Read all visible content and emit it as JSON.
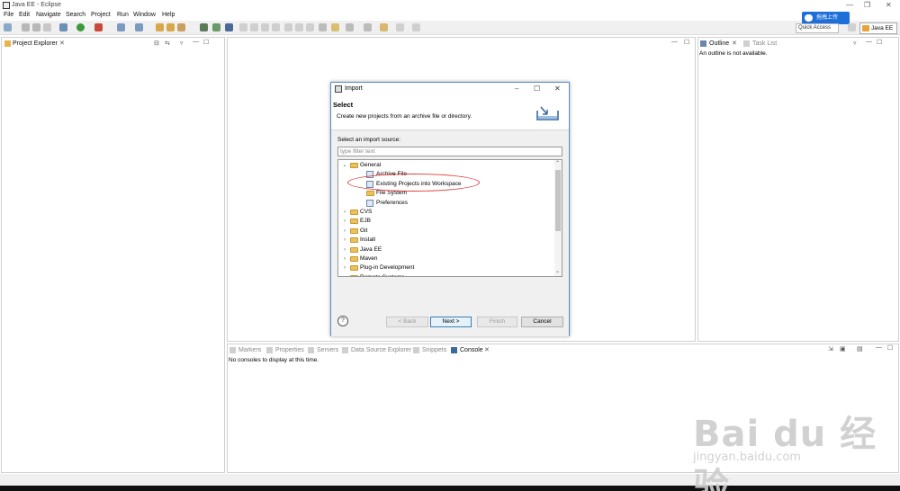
{
  "window": {
    "title": "Java EE - Eclipse",
    "minimize": "—",
    "restore": "❐",
    "close": "✕"
  },
  "menu": [
    "File",
    "Edit",
    "Navigate",
    "Search",
    "Project",
    "Run",
    "Window",
    "Help"
  ],
  "toolbar": {
    "quick_access": "Quick Access",
    "perspective": "Java EE",
    "baidu_upload": "拖拽上传"
  },
  "project_explorer": {
    "tab": "Project Explorer"
  },
  "outline": {
    "tabs": [
      "Outline",
      "Task List"
    ],
    "message": "An outline is not available."
  },
  "bottom_panel": {
    "tabs": [
      "Markers",
      "Properties",
      "Servers",
      "Data Source Explorer",
      "Snippets",
      "Console"
    ],
    "message": "No consoles to display at this time."
  },
  "dialog": {
    "title": "Import",
    "heading": "Select",
    "description": "Create new projects from an archive file or directory.",
    "source_label": "Select an import source:",
    "filter_placeholder": "type filter text",
    "tree": [
      {
        "label": "General",
        "level": 0,
        "expanded": true,
        "type": "folder"
      },
      {
        "label": "Archive File",
        "level": 1,
        "type": "item"
      },
      {
        "label": "Existing Projects into Workspace",
        "level": 1,
        "type": "item",
        "highlighted": true
      },
      {
        "label": "File System",
        "level": 1,
        "type": "folder"
      },
      {
        "label": "Preferences",
        "level": 1,
        "type": "item"
      },
      {
        "label": "CVS",
        "level": 0,
        "type": "folder"
      },
      {
        "label": "EJB",
        "level": 0,
        "type": "folder"
      },
      {
        "label": "Git",
        "level": 0,
        "type": "folder"
      },
      {
        "label": "Install",
        "level": 0,
        "type": "folder"
      },
      {
        "label": "Java EE",
        "level": 0,
        "type": "folder"
      },
      {
        "label": "Maven",
        "level": 0,
        "type": "folder"
      },
      {
        "label": "Plug-in Development",
        "level": 0,
        "type": "folder"
      },
      {
        "label": "Remote Systems",
        "level": 0,
        "type": "folder"
      }
    ],
    "buttons": {
      "back": "< Back",
      "next": "Next >",
      "finish": "Finish",
      "cancel": "Cancel"
    },
    "help": "?"
  },
  "watermark": {
    "main": "Bai du 经验",
    "sub": "jingyan.baidu.com"
  },
  "colors": {
    "accent": "#1e6fd9",
    "highlight_ellipse": "#e23b3b",
    "folder": "#e9c25f"
  }
}
